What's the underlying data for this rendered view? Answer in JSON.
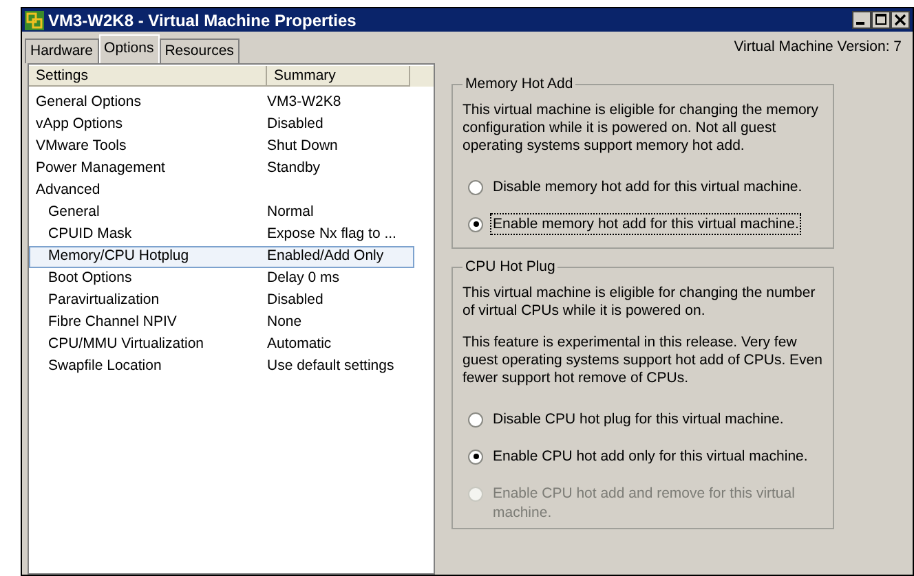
{
  "window": {
    "title": "VM3-W2K8 - Virtual Machine Properties"
  },
  "tabs": [
    {
      "label": "Hardware",
      "selected": false
    },
    {
      "label": "Options",
      "selected": true
    },
    {
      "label": "Resources",
      "selected": false
    }
  ],
  "version": "Virtual Machine Version: 7",
  "settings": {
    "columns": [
      "Settings",
      "Summary"
    ],
    "rows": [
      {
        "name": "General Options",
        "summary": "VM3-W2K8",
        "selected": false
      },
      {
        "name": "vApp Options",
        "summary": "Disabled",
        "selected": false
      },
      {
        "name": "VMware Tools",
        "summary": "Shut Down",
        "selected": false
      },
      {
        "name": "Power Management",
        "summary": "Standby",
        "selected": false
      },
      {
        "name": "Advanced",
        "selected": false,
        "children": [
          {
            "name": "General",
            "summary": "Normal",
            "selected": false
          },
          {
            "name": "CPUID Mask",
            "summary": "Expose Nx flag to ...",
            "selected": false
          },
          {
            "name": "Memory/CPU Hotplug",
            "summary": "Enabled/Add Only",
            "selected": true
          },
          {
            "name": "Boot Options",
            "summary": "Delay 0 ms",
            "selected": false
          },
          {
            "name": "Paravirtualization",
            "summary": "Disabled",
            "selected": false
          },
          {
            "name": "Fibre Channel NPIV",
            "summary": "None",
            "selected": false
          },
          {
            "name": "CPU/MMU Virtualization",
            "summary": "Automatic",
            "selected": false
          },
          {
            "name": "Swapfile Location",
            "summary": "Use default settings",
            "selected": false
          }
        ]
      }
    ]
  },
  "groups": [
    {
      "title": "Memory Hot Add",
      "descriptions": [
        "This virtual machine is eligible for changing the memory configuration while it is powered on. Not all guest operating systems support memory hot add."
      ],
      "options": [
        {
          "label": "Disable memory hot add for this virtual machine.",
          "selected": false,
          "disabled": false,
          "focused": false
        },
        {
          "label": "Enable memory hot add for this virtual machine.",
          "selected": true,
          "disabled": false,
          "focused": true
        }
      ]
    },
    {
      "title": "CPU Hot Plug",
      "descriptions": [
        "This virtual machine is eligible for changing the number of virtual CPUs while it is powered on.",
        "This feature is experimental in this release. Very few guest operating systems support hot add of CPUs. Even fewer support hot remove of CPUs."
      ],
      "options": [
        {
          "label": "Disable CPU hot plug for this virtual machine.",
          "selected": false,
          "disabled": false,
          "focused": false
        },
        {
          "label": "Enable CPU hot add only for this virtual machine.",
          "selected": true,
          "disabled": false,
          "focused": false
        },
        {
          "label": "Enable CPU hot add and remove for this virtual machine.",
          "selected": false,
          "disabled": true,
          "focused": false
        }
      ]
    }
  ]
}
